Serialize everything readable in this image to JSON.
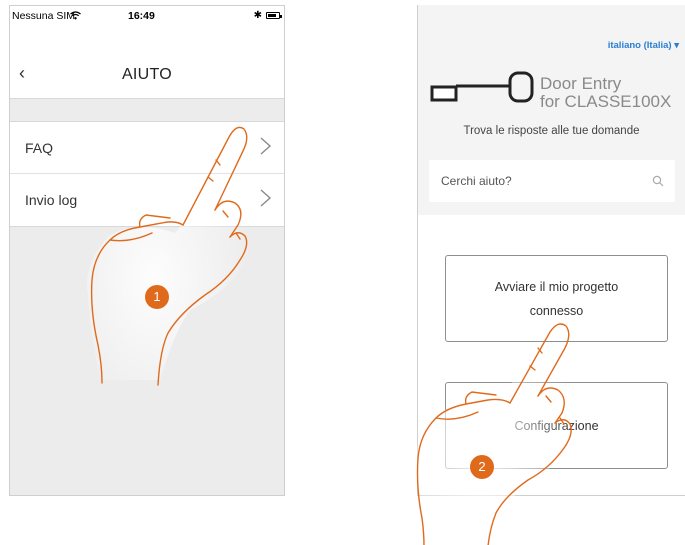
{
  "left_screen": {
    "status_bar": {
      "carrier": "Nessuna SIM",
      "time": "16:49"
    },
    "header": {
      "title": "AIUTO"
    },
    "items": [
      {
        "label": "FAQ"
      },
      {
        "label": "Invio log"
      }
    ]
  },
  "right_screen": {
    "language": "italiano (Italia) ▾",
    "logo": {
      "line1": "Door Entry",
      "line2": "for CLASSE100X"
    },
    "tagline": "Trova le risposte alle tue domande",
    "search": {
      "placeholder": "Cerchi aiuto?"
    },
    "cards": [
      {
        "label": "Avviare il mio progetto connesso"
      },
      {
        "label": "Configurazione"
      }
    ]
  },
  "callouts": [
    "1",
    "2"
  ],
  "colors": {
    "accent": "#e06a1c",
    "link": "#2a7fd4",
    "hand_stroke": "#e06a1c"
  }
}
